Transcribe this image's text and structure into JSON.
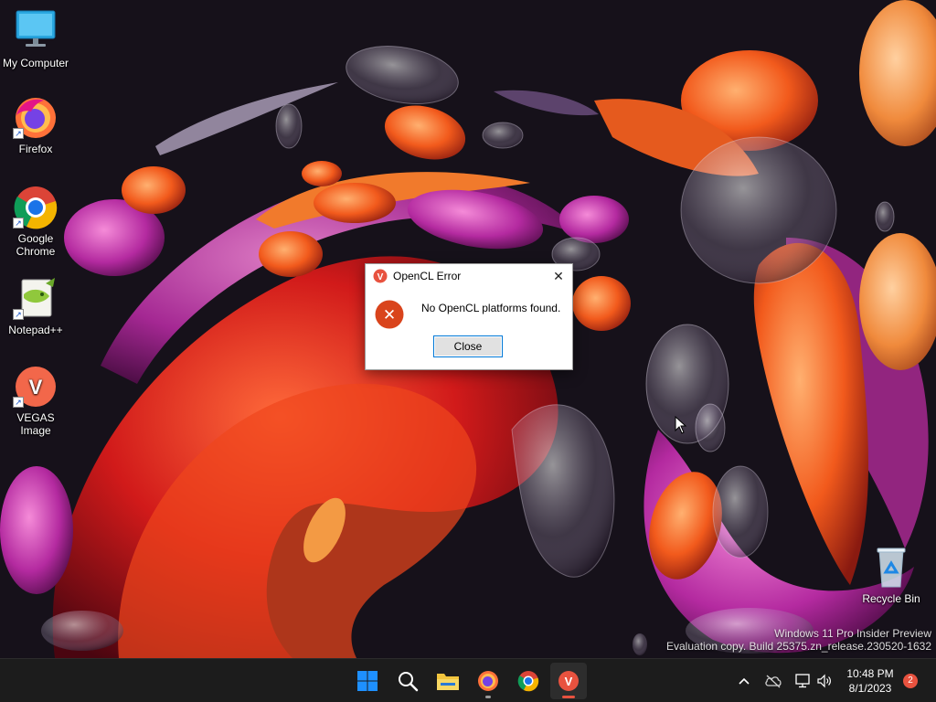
{
  "desktop": {
    "icons": [
      {
        "label": "My Computer"
      },
      {
        "label": "Firefox"
      },
      {
        "label": "Google Chrome"
      },
      {
        "label": "Notepad++"
      },
      {
        "label": "VEGAS Image"
      },
      {
        "label": "Recycle Bin"
      }
    ],
    "watermark": {
      "line1": "Windows 11 Pro Insider Preview",
      "line2": "Evaluation copy. Build 25375.zn_release.230520-1632"
    }
  },
  "dialog": {
    "title": "OpenCL Error",
    "message": "No OpenCL platforms found.",
    "close_button": "Close",
    "close_glyph": "✕",
    "error_glyph": "✕",
    "app_glyph": "V"
  },
  "taskbar": {
    "vegas_glyph": "V",
    "clock": {
      "time": "10:48 PM",
      "date": "8/1/2023"
    },
    "notification_count": "2",
    "tray_chevron": "^"
  },
  "colors": {
    "taskbar_bg": "#1c1c1c",
    "vegas_orange": "#e8523f",
    "error_red": "#d9441c",
    "windows_blue": "#1e90ff",
    "chrome_blue": "#1a73e8",
    "folder_yellow": "#f2c53d"
  }
}
